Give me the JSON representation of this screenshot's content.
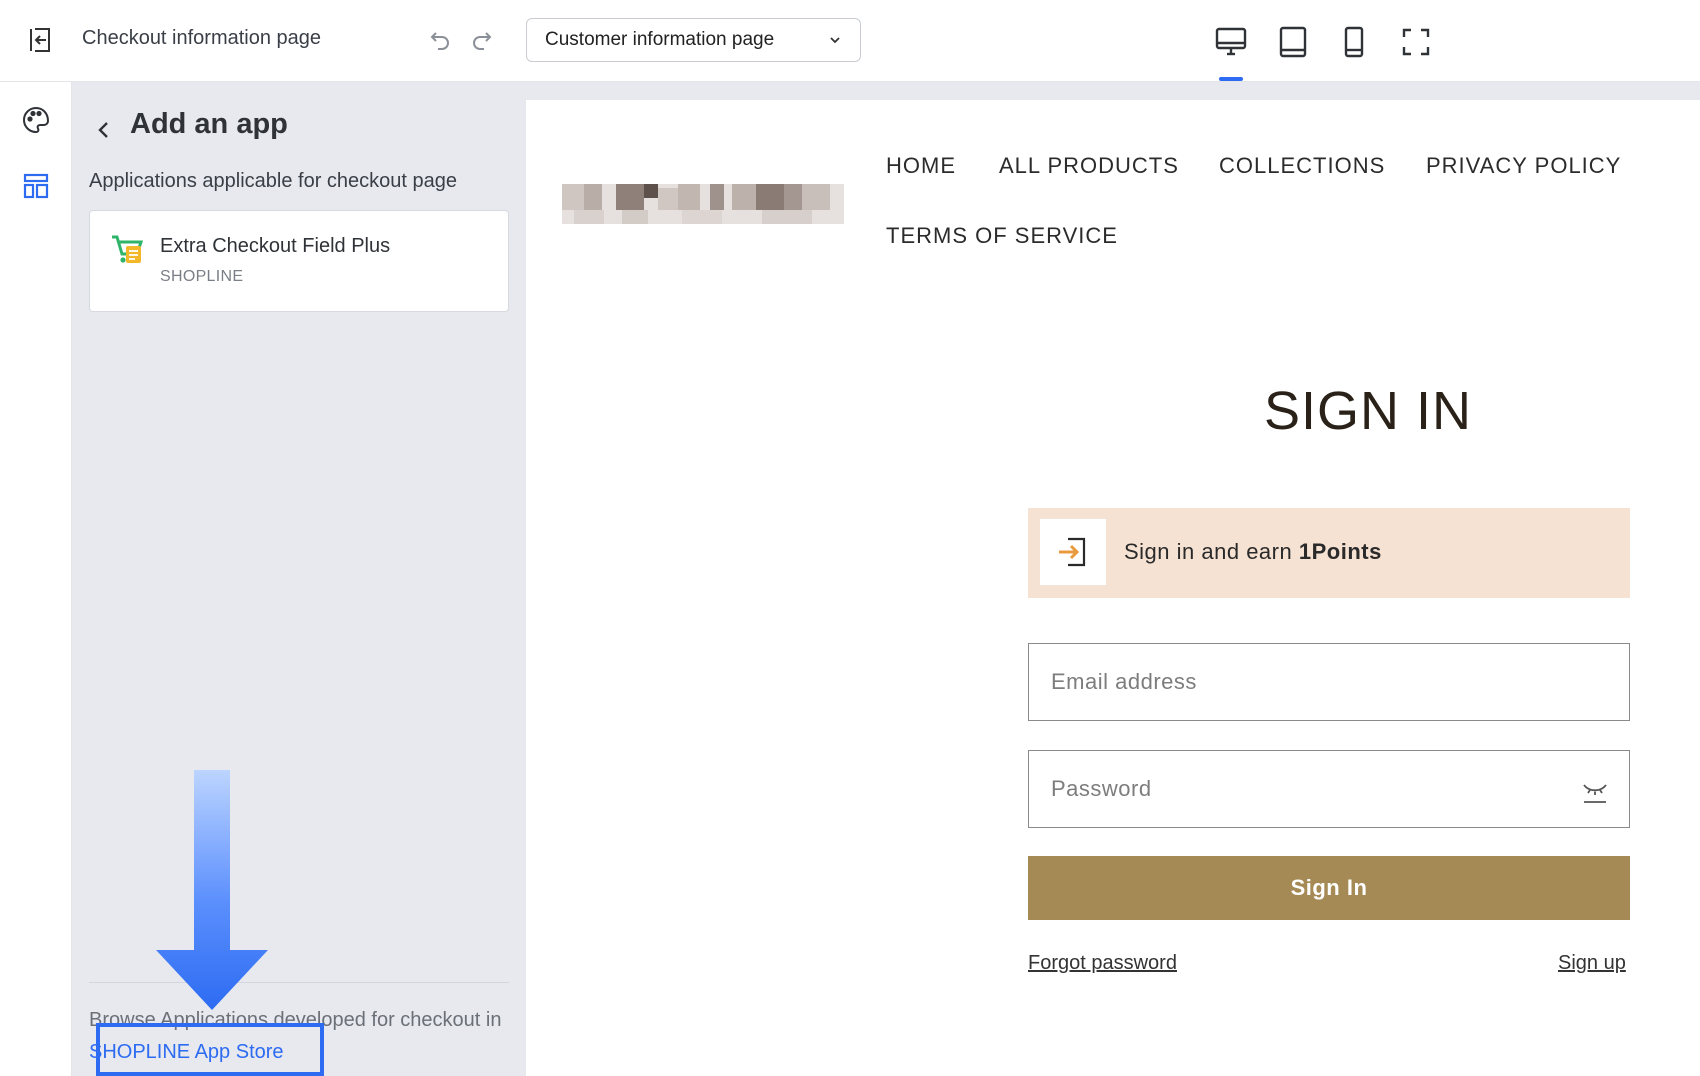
{
  "header": {
    "page_title": "Checkout information page",
    "page_select": {
      "selected": "Customer information page"
    },
    "devices": [
      "desktop-icon",
      "tablet-icon",
      "mobile-icon",
      "fullscreen-icon"
    ],
    "active_device": "desktop",
    "accent": "#2d6bf2"
  },
  "rail": {
    "items": [
      "palette-icon",
      "layout-icon"
    ]
  },
  "panel": {
    "title": "Add an app",
    "subtitle": "Applications applicable for checkout page",
    "apps": [
      {
        "name": "Extra Checkout Field Plus",
        "vendor": "SHOPLINE"
      }
    ],
    "browse_text": "Browse Applications developed for checkout in",
    "store_link": "SHOPLINE App Store"
  },
  "preview": {
    "nav": [
      "HOME",
      "ALL PRODUCTS",
      "COLLECTIONS",
      "PRIVACY POLICY",
      "TERMS OF SERVICE"
    ],
    "heading": "SIGN IN",
    "points_banner": {
      "text": "Sign in and earn",
      "points": "1Points"
    },
    "email_placeholder": "Email address",
    "password_placeholder": "Password",
    "signin_button": "Sign In",
    "forgot_password": "Forgot password",
    "sign_up": "Sign up",
    "button_color": "#a68a55",
    "banner_color": "#f6e2d3"
  }
}
